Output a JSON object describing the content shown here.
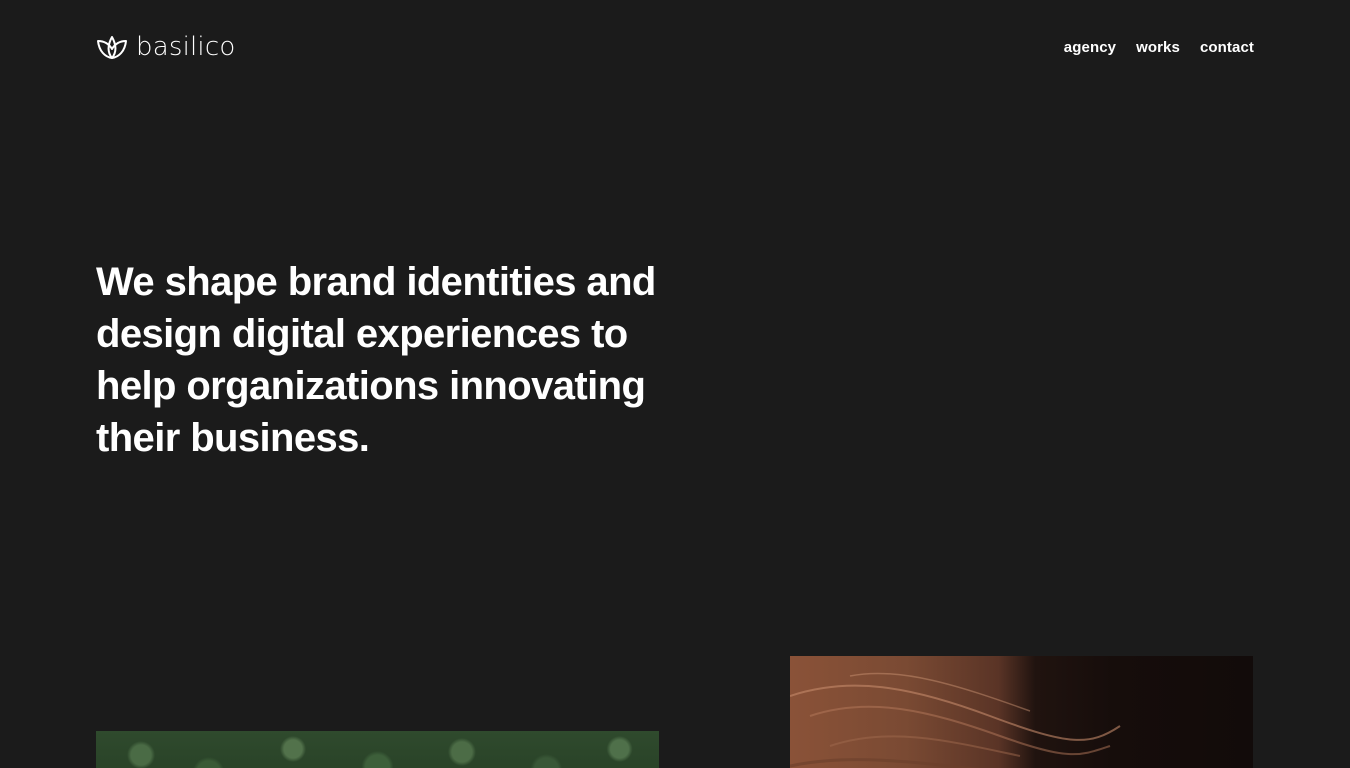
{
  "brand": {
    "name": "basilico",
    "logo_icon": "leaf-icon"
  },
  "nav": {
    "items": [
      {
        "label": "agency"
      },
      {
        "label": "works"
      },
      {
        "label": "contact"
      }
    ]
  },
  "hero": {
    "heading": "We shape brand identities and design digital experiences to help organizations innovating their business."
  },
  "gallery": {
    "images": [
      {
        "name": "forest-image"
      },
      {
        "name": "hair-portrait-image"
      }
    ]
  },
  "colors": {
    "background": "#1b1b1b",
    "text": "#ffffff"
  }
}
